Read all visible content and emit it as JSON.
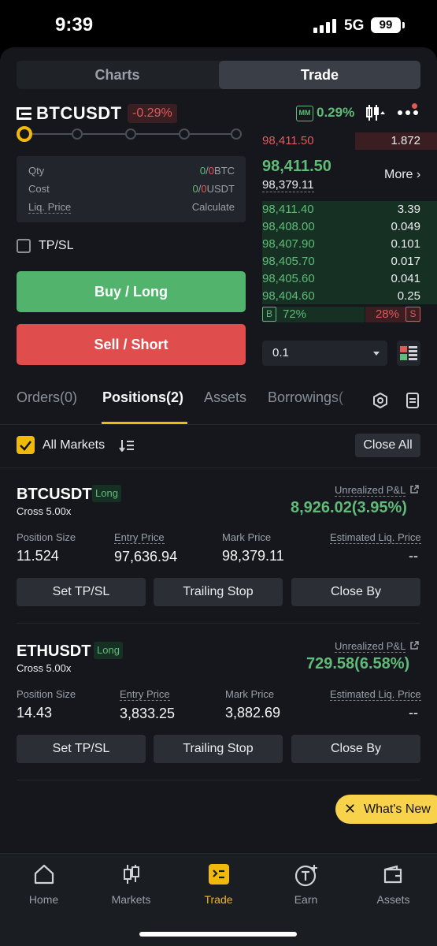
{
  "status_bar": {
    "time": "9:39",
    "network": "5G",
    "battery": "99"
  },
  "segments": {
    "charts": "Charts",
    "trade": "Trade"
  },
  "header": {
    "symbol": "BTCUSDT",
    "change": "-0.29%",
    "mm_badge": "MM",
    "mm_value": "0.29%"
  },
  "order_form": {
    "slider_level": 0,
    "qty_label": "Qty",
    "qty_zero": "0",
    "qty_sep": "/",
    "qty_value": "0",
    "qty_unit": "BTC",
    "cost_label": "Cost",
    "cost_zero": "0",
    "cost_sep": "/",
    "cost_value": "0",
    "cost_unit": "USDT",
    "liq_label": "Liq. Price",
    "liq_value": "Calculate",
    "tpsl_label": "TP/SL",
    "buy_label": "Buy / Long",
    "sell_label": "Sell / Short"
  },
  "order_book": {
    "top_ask": {
      "price": "98,411.50",
      "qty": "1.872"
    },
    "last_price": "98,411.50",
    "mark_price": "98,379.11",
    "more_label": "More",
    "bids": [
      {
        "price": "98,411.40",
        "qty": "3.39"
      },
      {
        "price": "98,408.00",
        "qty": "0.049"
      },
      {
        "price": "98,407.90",
        "qty": "0.101"
      },
      {
        "price": "98,405.70",
        "qty": "0.017"
      },
      {
        "price": "98,405.60",
        "qty": "0.041"
      },
      {
        "price": "98,404.60",
        "qty": "0.25"
      }
    ],
    "buy_badge": "B",
    "buy_pct": "72%",
    "sell_badge": "S",
    "sell_pct": "28%",
    "qty_select": "0.1"
  },
  "tabs": {
    "orders": "Orders(0)",
    "positions": "Positions(2)",
    "assets": "Assets",
    "borrowings": "Borrowings("
  },
  "filter": {
    "all_markets": "All Markets",
    "close_all": "Close All"
  },
  "positions": [
    {
      "symbol": "BTCUSDT",
      "side": "Long",
      "margin": "Cross 5.00x",
      "upl_label": "Unrealized P&L",
      "upl_value": "8,926.02(3.95%)",
      "size_label": "Position Size",
      "size": "11.524",
      "entry_label": "Entry Price",
      "entry": "97,636.94",
      "mark_label": "Mark Price",
      "mark": "98,379.11",
      "liq_label": "Estimated Liq. Price",
      "liq": "--",
      "btn_tpsl": "Set TP/SL",
      "btn_trailing": "Trailing Stop",
      "btn_close": "Close By"
    },
    {
      "symbol": "ETHUSDT",
      "side": "Long",
      "margin": "Cross 5.00x",
      "upl_label": "Unrealized P&L",
      "upl_value": "729.58(6.58%)",
      "size_label": "Position Size",
      "size": "14.43",
      "entry_label": "Entry Price",
      "entry": "3,833.25",
      "mark_label": "Mark Price",
      "mark": "3,882.69",
      "liq_label": "Estimated Liq. Price",
      "liq": "--",
      "btn_tpsl": "Set TP/SL",
      "btn_trailing": "Trailing Stop",
      "btn_close": "Close By"
    }
  ],
  "whats_new": {
    "close": "✕",
    "label": "What's New"
  },
  "nav": [
    {
      "label": "Home",
      "icon": "home-icon"
    },
    {
      "label": "Markets",
      "icon": "markets-icon"
    },
    {
      "label": "Trade",
      "icon": "trade-icon",
      "active": true
    },
    {
      "label": "Earn",
      "icon": "earn-icon"
    },
    {
      "label": "Assets",
      "icon": "wallet-icon"
    }
  ],
  "colors": {
    "accent": "#f0b90b",
    "green": "#5fbb77",
    "red": "#e15a5a",
    "background": "#15171c"
  }
}
